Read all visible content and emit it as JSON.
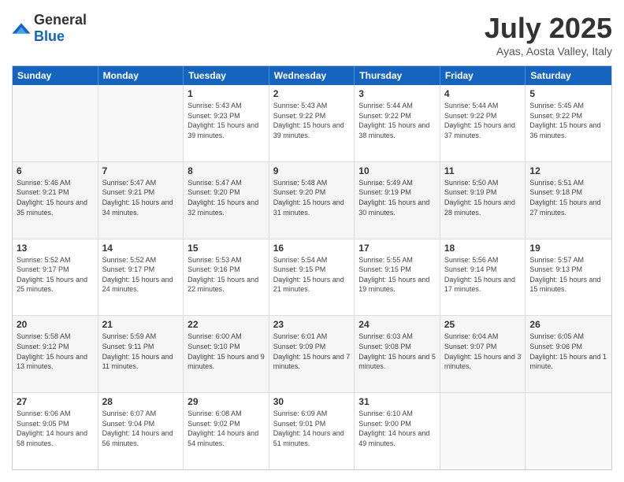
{
  "header": {
    "logo_general": "General",
    "logo_blue": "Blue",
    "month_title": "July 2025",
    "location": "Ayas, Aosta Valley, Italy"
  },
  "weekdays": [
    "Sunday",
    "Monday",
    "Tuesday",
    "Wednesday",
    "Thursday",
    "Friday",
    "Saturday"
  ],
  "rows": [
    [
      {
        "day": "",
        "sunrise": "",
        "sunset": "",
        "daylight": "",
        "empty": true
      },
      {
        "day": "",
        "sunrise": "",
        "sunset": "",
        "daylight": "",
        "empty": true
      },
      {
        "day": "1",
        "sunrise": "Sunrise: 5:43 AM",
        "sunset": "Sunset: 9:23 PM",
        "daylight": "Daylight: 15 hours and 39 minutes.",
        "empty": false
      },
      {
        "day": "2",
        "sunrise": "Sunrise: 5:43 AM",
        "sunset": "Sunset: 9:22 PM",
        "daylight": "Daylight: 15 hours and 39 minutes.",
        "empty": false
      },
      {
        "day": "3",
        "sunrise": "Sunrise: 5:44 AM",
        "sunset": "Sunset: 9:22 PM",
        "daylight": "Daylight: 15 hours and 38 minutes.",
        "empty": false
      },
      {
        "day": "4",
        "sunrise": "Sunrise: 5:44 AM",
        "sunset": "Sunset: 9:22 PM",
        "daylight": "Daylight: 15 hours and 37 minutes.",
        "empty": false
      },
      {
        "day": "5",
        "sunrise": "Sunrise: 5:45 AM",
        "sunset": "Sunset: 9:22 PM",
        "daylight": "Daylight: 15 hours and 36 minutes.",
        "empty": false
      }
    ],
    [
      {
        "day": "6",
        "sunrise": "Sunrise: 5:46 AM",
        "sunset": "Sunset: 9:21 PM",
        "daylight": "Daylight: 15 hours and 35 minutes.",
        "empty": false
      },
      {
        "day": "7",
        "sunrise": "Sunrise: 5:47 AM",
        "sunset": "Sunset: 9:21 PM",
        "daylight": "Daylight: 15 hours and 34 minutes.",
        "empty": false
      },
      {
        "day": "8",
        "sunrise": "Sunrise: 5:47 AM",
        "sunset": "Sunset: 9:20 PM",
        "daylight": "Daylight: 15 hours and 32 minutes.",
        "empty": false
      },
      {
        "day": "9",
        "sunrise": "Sunrise: 5:48 AM",
        "sunset": "Sunset: 9:20 PM",
        "daylight": "Daylight: 15 hours and 31 minutes.",
        "empty": false
      },
      {
        "day": "10",
        "sunrise": "Sunrise: 5:49 AM",
        "sunset": "Sunset: 9:19 PM",
        "daylight": "Daylight: 15 hours and 30 minutes.",
        "empty": false
      },
      {
        "day": "11",
        "sunrise": "Sunrise: 5:50 AM",
        "sunset": "Sunset: 9:19 PM",
        "daylight": "Daylight: 15 hours and 28 minutes.",
        "empty": false
      },
      {
        "day": "12",
        "sunrise": "Sunrise: 5:51 AM",
        "sunset": "Sunset: 9:18 PM",
        "daylight": "Daylight: 15 hours and 27 minutes.",
        "empty": false
      }
    ],
    [
      {
        "day": "13",
        "sunrise": "Sunrise: 5:52 AM",
        "sunset": "Sunset: 9:17 PM",
        "daylight": "Daylight: 15 hours and 25 minutes.",
        "empty": false
      },
      {
        "day": "14",
        "sunrise": "Sunrise: 5:52 AM",
        "sunset": "Sunset: 9:17 PM",
        "daylight": "Daylight: 15 hours and 24 minutes.",
        "empty": false
      },
      {
        "day": "15",
        "sunrise": "Sunrise: 5:53 AM",
        "sunset": "Sunset: 9:16 PM",
        "daylight": "Daylight: 15 hours and 22 minutes.",
        "empty": false
      },
      {
        "day": "16",
        "sunrise": "Sunrise: 5:54 AM",
        "sunset": "Sunset: 9:15 PM",
        "daylight": "Daylight: 15 hours and 21 minutes.",
        "empty": false
      },
      {
        "day": "17",
        "sunrise": "Sunrise: 5:55 AM",
        "sunset": "Sunset: 9:15 PM",
        "daylight": "Daylight: 15 hours and 19 minutes.",
        "empty": false
      },
      {
        "day": "18",
        "sunrise": "Sunrise: 5:56 AM",
        "sunset": "Sunset: 9:14 PM",
        "daylight": "Daylight: 15 hours and 17 minutes.",
        "empty": false
      },
      {
        "day": "19",
        "sunrise": "Sunrise: 5:57 AM",
        "sunset": "Sunset: 9:13 PM",
        "daylight": "Daylight: 15 hours and 15 minutes.",
        "empty": false
      }
    ],
    [
      {
        "day": "20",
        "sunrise": "Sunrise: 5:58 AM",
        "sunset": "Sunset: 9:12 PM",
        "daylight": "Daylight: 15 hours and 13 minutes.",
        "empty": false
      },
      {
        "day": "21",
        "sunrise": "Sunrise: 5:59 AM",
        "sunset": "Sunset: 9:11 PM",
        "daylight": "Daylight: 15 hours and 11 minutes.",
        "empty": false
      },
      {
        "day": "22",
        "sunrise": "Sunrise: 6:00 AM",
        "sunset": "Sunset: 9:10 PM",
        "daylight": "Daylight: 15 hours and 9 minutes.",
        "empty": false
      },
      {
        "day": "23",
        "sunrise": "Sunrise: 6:01 AM",
        "sunset": "Sunset: 9:09 PM",
        "daylight": "Daylight: 15 hours and 7 minutes.",
        "empty": false
      },
      {
        "day": "24",
        "sunrise": "Sunrise: 6:03 AM",
        "sunset": "Sunset: 9:08 PM",
        "daylight": "Daylight: 15 hours and 5 minutes.",
        "empty": false
      },
      {
        "day": "25",
        "sunrise": "Sunrise: 6:04 AM",
        "sunset": "Sunset: 9:07 PM",
        "daylight": "Daylight: 15 hours and 3 minutes.",
        "empty": false
      },
      {
        "day": "26",
        "sunrise": "Sunrise: 6:05 AM",
        "sunset": "Sunset: 9:06 PM",
        "daylight": "Daylight: 15 hours and 1 minute.",
        "empty": false
      }
    ],
    [
      {
        "day": "27",
        "sunrise": "Sunrise: 6:06 AM",
        "sunset": "Sunset: 9:05 PM",
        "daylight": "Daylight: 14 hours and 58 minutes.",
        "empty": false
      },
      {
        "day": "28",
        "sunrise": "Sunrise: 6:07 AM",
        "sunset": "Sunset: 9:04 PM",
        "daylight": "Daylight: 14 hours and 56 minutes.",
        "empty": false
      },
      {
        "day": "29",
        "sunrise": "Sunrise: 6:08 AM",
        "sunset": "Sunset: 9:02 PM",
        "daylight": "Daylight: 14 hours and 54 minutes.",
        "empty": false
      },
      {
        "day": "30",
        "sunrise": "Sunrise: 6:09 AM",
        "sunset": "Sunset: 9:01 PM",
        "daylight": "Daylight: 14 hours and 51 minutes.",
        "empty": false
      },
      {
        "day": "31",
        "sunrise": "Sunrise: 6:10 AM",
        "sunset": "Sunset: 9:00 PM",
        "daylight": "Daylight: 14 hours and 49 minutes.",
        "empty": false
      },
      {
        "day": "",
        "sunrise": "",
        "sunset": "",
        "daylight": "",
        "empty": true
      },
      {
        "day": "",
        "sunrise": "",
        "sunset": "",
        "daylight": "",
        "empty": true
      }
    ]
  ]
}
